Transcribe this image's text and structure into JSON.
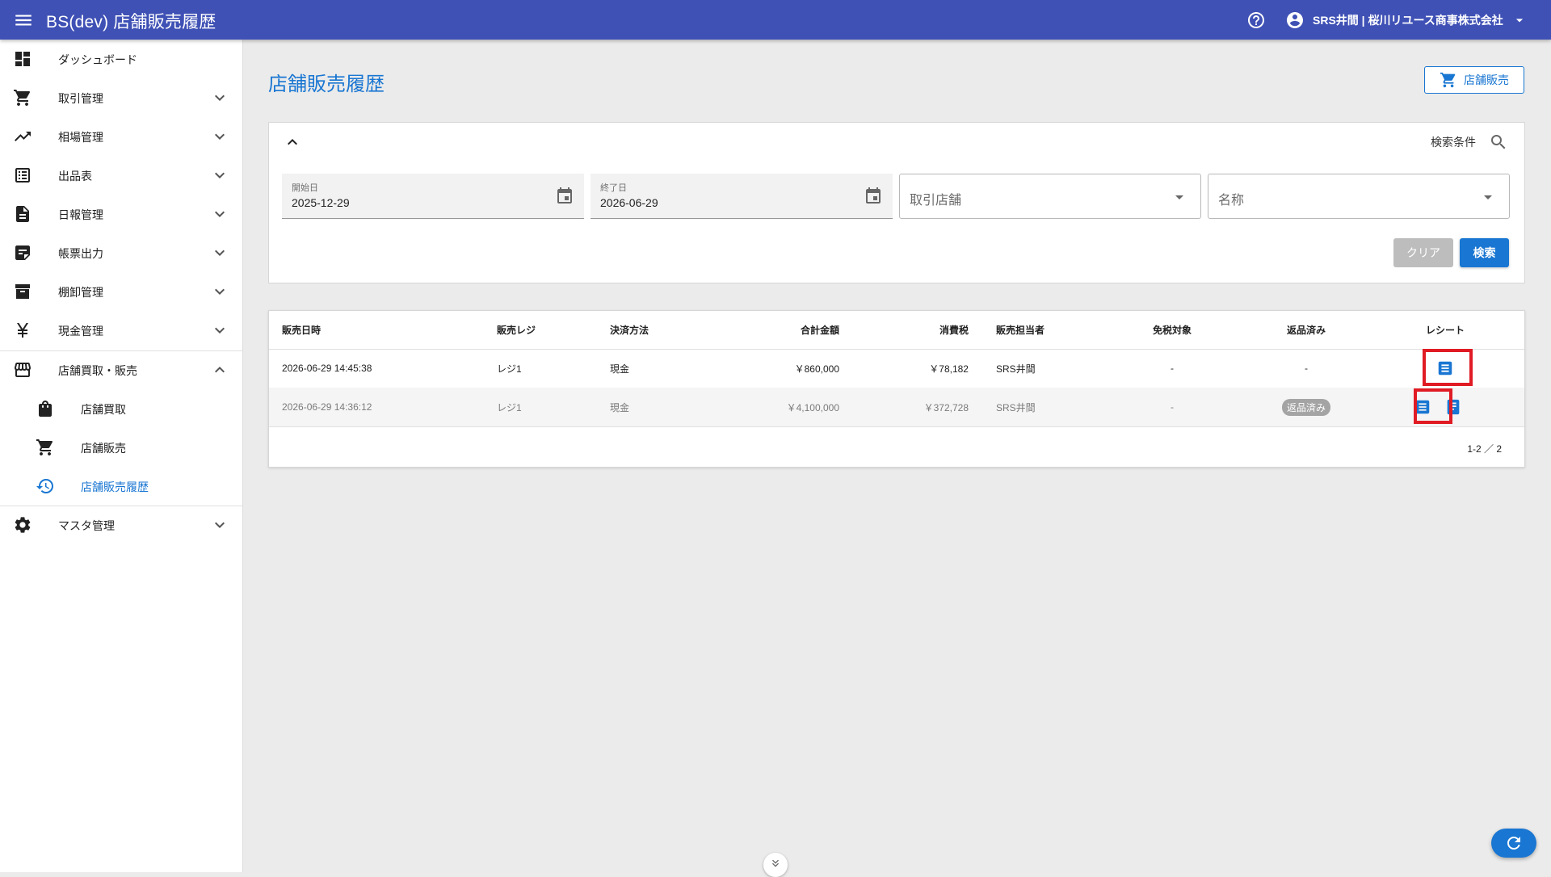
{
  "app": {
    "title": "BS(dev) 店舗販売履歴",
    "account_name": "SRS井間 | 桜川リユース商事株式会社",
    "accent_color": "#3f51b5",
    "primary_color": "#1976d2"
  },
  "sidebar": {
    "items": [
      {
        "label": "ダッシュボード",
        "icon": "dashboard-icon",
        "has_chevron": false
      },
      {
        "label": "取引管理",
        "icon": "cart-icon",
        "has_chevron": true
      },
      {
        "label": "相場管理",
        "icon": "trending-up-icon",
        "has_chevron": true
      },
      {
        "label": "出品表",
        "icon": "list-icon",
        "has_chevron": true
      },
      {
        "label": "日報管理",
        "icon": "document-icon",
        "has_chevron": true
      },
      {
        "label": "帳票出力",
        "icon": "note-icon",
        "has_chevron": true
      },
      {
        "label": "棚卸管理",
        "icon": "archive-icon",
        "has_chevron": true
      },
      {
        "label": "現金管理",
        "icon": "yen-icon",
        "has_chevron": true
      },
      {
        "label": "店舗買取・販売",
        "icon": "store-icon",
        "has_chevron": true,
        "expanded": true
      },
      {
        "label": "店舗買取",
        "icon": "shopping-bag-icon",
        "sub": true
      },
      {
        "label": "店舗販売",
        "icon": "cart-icon",
        "sub": true
      },
      {
        "label": "店舗販売履歴",
        "icon": "history-icon",
        "sub": true,
        "active": true
      },
      {
        "label": "マスタ管理",
        "icon": "gear-icon",
        "has_chevron": true
      }
    ]
  },
  "main": {
    "page_title": "店舗販売履歴",
    "store_sale_button": "店舗販売",
    "search": {
      "condition_label": "検索条件",
      "start_date_label": "開始日",
      "start_date_value": "2025-12-29",
      "end_date_label": "終了日",
      "end_date_value": "2026-06-29",
      "store_placeholder": "取引店舗",
      "name_placeholder": "名称",
      "clear_label": "クリア",
      "search_label": "検索"
    },
    "table": {
      "columns": [
        "販売日時",
        "販売レジ",
        "決済方法",
        "合計金額",
        "消費税",
        "販売担当者",
        "免税対象",
        "返品済み",
        "レシート"
      ],
      "rows": [
        {
          "datetime": "2026-06-29 14:45:38",
          "register": "レジ1",
          "payment": "現金",
          "total": "￥860,000",
          "tax": "￥78,182",
          "staff": "SRS井間",
          "tax_free": "-",
          "returned": "-",
          "returned_badge": false
        },
        {
          "datetime": "2026-06-29 14:36:12",
          "register": "レジ1",
          "payment": "現金",
          "total": "￥4,100,000",
          "tax": "￥372,728",
          "staff": "SRS井間",
          "tax_free": "-",
          "returned": "返品済み",
          "returned_badge": true
        }
      ],
      "pagination": "1-2 ／ 2"
    }
  }
}
